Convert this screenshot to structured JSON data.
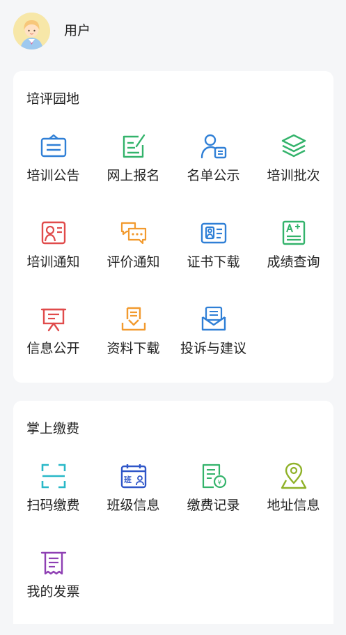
{
  "header": {
    "username": "用户",
    "avatar_icon": "user-avatar-icon"
  },
  "sections": [
    {
      "title": "培评园地",
      "items": [
        {
          "label": "培训公告",
          "icon": "announcement-icon",
          "color": "#2f7fd6"
        },
        {
          "label": "网上报名",
          "icon": "form-edit-icon",
          "color": "#33b36b"
        },
        {
          "label": "名单公示",
          "icon": "user-list-icon",
          "color": "#2f7fd6"
        },
        {
          "label": "培训批次",
          "icon": "layers-icon",
          "color": "#33b36b"
        },
        {
          "label": "培训通知",
          "icon": "notice-user-icon",
          "color": "#e04b4b"
        },
        {
          "label": "评价通知",
          "icon": "chat-bubble-icon",
          "color": "#f29a2e"
        },
        {
          "label": "证书下载",
          "icon": "id-card-icon",
          "color": "#2f7fd6"
        },
        {
          "label": "成绩查询",
          "icon": "grade-icon",
          "color": "#33b36b"
        },
        {
          "label": "信息公开",
          "icon": "presentation-icon",
          "color": "#e04b4b"
        },
        {
          "label": "资料下载",
          "icon": "download-icon",
          "color": "#f29a2e"
        },
        {
          "label": "投诉与建议",
          "icon": "mail-icon",
          "color": "#2f7fd6"
        }
      ]
    },
    {
      "title": "掌上缴费",
      "items": [
        {
          "label": "扫码缴费",
          "icon": "scan-icon",
          "color": "#29b8c8"
        },
        {
          "label": "班级信息",
          "icon": "class-calendar-icon",
          "color": "#2f56c8"
        },
        {
          "label": "缴费记录",
          "icon": "payment-record-icon",
          "color": "#33b36b"
        },
        {
          "label": "地址信息",
          "icon": "location-pin-icon",
          "color": "#8fb128"
        },
        {
          "label": "我的发票",
          "icon": "invoice-icon",
          "color": "#8e3fb3"
        }
      ]
    }
  ]
}
